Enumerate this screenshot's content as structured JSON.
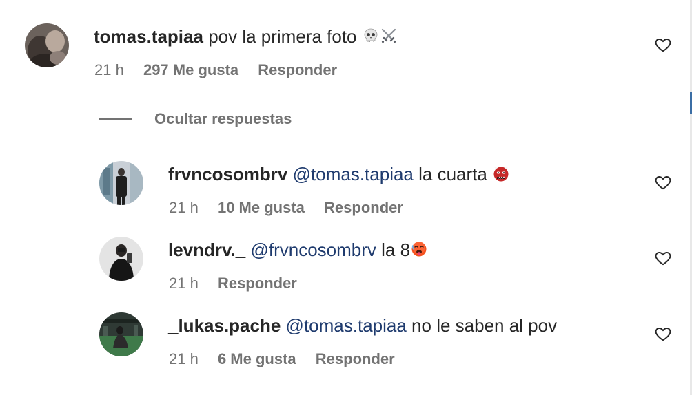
{
  "main_comment": {
    "username": "tomas.tapiaa",
    "text": "pov la primera foto",
    "emoji_icons": [
      "skull-icon",
      "crossed-swords-icon"
    ],
    "time": "21 h",
    "likes": "297 Me gusta",
    "reply_label": "Responder"
  },
  "replies_toggle": {
    "label": "Ocultar respuestas"
  },
  "replies": [
    {
      "username": "frvncosombrv",
      "mention": "@tomas.tapiaa",
      "text": "la cuarta",
      "emoji_icon": "ogre-icon",
      "time": "21 h",
      "likes": "10 Me gusta",
      "reply_label": "Responder"
    },
    {
      "username": "levndrv._",
      "mention": "@frvncosombrv",
      "text": "la 8",
      "emoji_icon": "hot-face-icon",
      "time": "21 h",
      "reply_label": "Responder"
    },
    {
      "username": "_lukas.pache",
      "mention": "@tomas.tapiaa",
      "text": "no le saben al pov",
      "time": "21 h",
      "likes": "6 Me gusta",
      "reply_label": "Responder"
    }
  ],
  "colors": {
    "text": "#262626",
    "secondary": "#737373",
    "mention": "#1f3b6e"
  }
}
